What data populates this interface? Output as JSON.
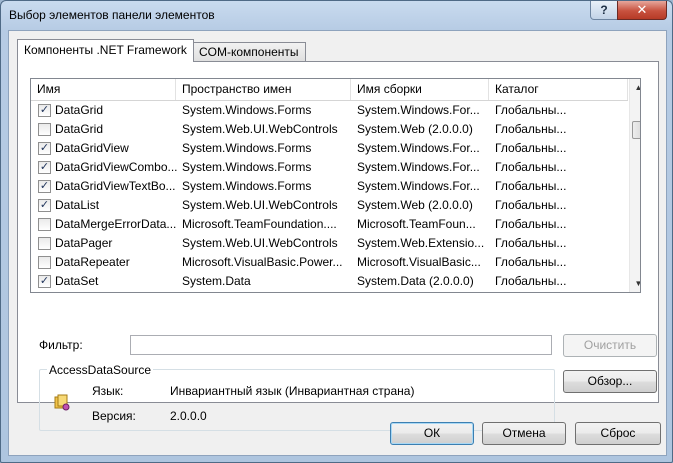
{
  "window": {
    "title": "Выбор элементов панели элементов",
    "help_glyph": "?",
    "close_glyph": "✕"
  },
  "tabs": [
    {
      "label": "Компоненты .NET Framework",
      "active": true
    },
    {
      "label": "COM-компоненты",
      "active": false
    }
  ],
  "list": {
    "columns": [
      "Имя",
      "Пространство имен",
      "Имя сборки",
      "Каталог"
    ],
    "rows": [
      {
        "checked": true,
        "name": "DataGrid",
        "namespace": "System.Windows.Forms",
        "assembly": "System.Windows.For...",
        "directory": "Глобальны..."
      },
      {
        "checked": false,
        "name": "DataGrid",
        "namespace": "System.Web.UI.WebControls",
        "assembly": "System.Web (2.0.0.0)",
        "directory": "Глобальны..."
      },
      {
        "checked": true,
        "name": "DataGridView",
        "namespace": "System.Windows.Forms",
        "assembly": "System.Windows.For...",
        "directory": "Глобальны..."
      },
      {
        "checked": true,
        "name": "DataGridViewCombo...",
        "namespace": "System.Windows.Forms",
        "assembly": "System.Windows.For...",
        "directory": "Глобальны..."
      },
      {
        "checked": true,
        "name": "DataGridViewTextBo...",
        "namespace": "System.Windows.Forms",
        "assembly": "System.Windows.For...",
        "directory": "Глобальны..."
      },
      {
        "checked": true,
        "name": "DataList",
        "namespace": "System.Web.UI.WebControls",
        "assembly": "System.Web (2.0.0.0)",
        "directory": "Глобальны..."
      },
      {
        "checked": false,
        "name": "DataMergeErrorData...",
        "namespace": "Microsoft.TeamFoundation....",
        "assembly": "Microsoft.TeamFoun...",
        "directory": "Глобальны..."
      },
      {
        "checked": false,
        "name": "DataPager",
        "namespace": "System.Web.UI.WebControls",
        "assembly": "System.Web.Extensio...",
        "directory": "Глобальны..."
      },
      {
        "checked": false,
        "name": "DataRepeater",
        "namespace": "Microsoft.VisualBasic.Power...",
        "assembly": "Microsoft.VisualBasic...",
        "directory": "Глобальны..."
      },
      {
        "checked": true,
        "name": "DataSet",
        "namespace": "System.Data",
        "assembly": "System.Data (2.0.0.0)",
        "directory": "Глобальны..."
      }
    ]
  },
  "filter": {
    "label": "Фильтр:",
    "value": "",
    "clear_button": "Очистить"
  },
  "details": {
    "title": "AccessDataSource",
    "language_label": "Язык:",
    "language_value": "Инвариантный язык (Инвариантная страна)",
    "version_label": "Версия:",
    "version_value": "2.0.0.0",
    "browse_button": "Обзор..."
  },
  "buttons": {
    "ok": "ОК",
    "cancel": "Отмена",
    "reset": "Сброс"
  }
}
